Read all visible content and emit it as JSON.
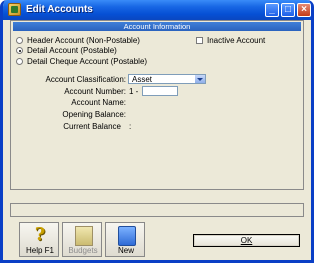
{
  "window": {
    "title": "Edit Accounts"
  },
  "section": {
    "header": "Account Information"
  },
  "account_type": {
    "options": [
      {
        "label": "Header Account (Non-Postable)",
        "selected": false
      },
      {
        "label": "Detail Account (Postable)",
        "selected": true
      },
      {
        "label": "Detail Cheque Account (Postable)",
        "selected": false
      }
    ]
  },
  "inactive": {
    "label": "Inactive Account",
    "checked": false
  },
  "fields": {
    "classification_label": "Account Classification:",
    "classification_value": "Asset",
    "number_label": "Account Number:",
    "number_prefix": "1 -",
    "number_value": "",
    "name_label": "Account Name:",
    "opening_label": "Opening Balance:",
    "current_label": "Current Balance",
    "current_value": ":"
  },
  "toolbar": {
    "help_label": "Help F1",
    "budgets_label": "Budgets",
    "new_label": "New"
  },
  "buttons": {
    "ok_label": "OK"
  },
  "colors": {
    "title_bar": "#0650d5",
    "section_header": "#2a62bd",
    "window_bg": "#ece9d8"
  }
}
